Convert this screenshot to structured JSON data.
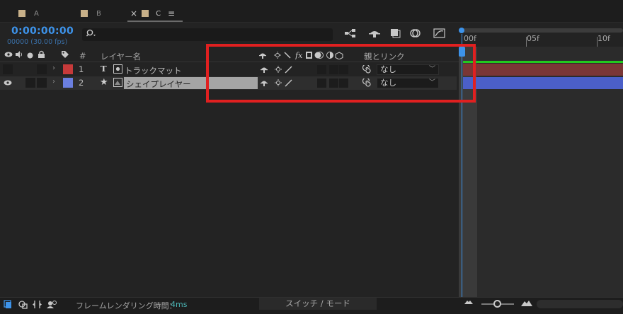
{
  "tabs": [
    {
      "label": "A",
      "active": false
    },
    {
      "label": "B",
      "active": false
    },
    {
      "label": "C",
      "active": true
    }
  ],
  "tab_close": "×",
  "tab_menu": "≡",
  "timecode": "0:00:00:00",
  "fps": "00000 (30.00 fps)",
  "ruler": {
    "ticks": [
      "00f",
      "05f",
      "10f"
    ]
  },
  "header": {
    "number": "#",
    "layer_name": "レイヤー名",
    "parent_link": "親とリンク"
  },
  "layers": [
    {
      "num": "1",
      "type_glyph": "T",
      "name": "トラックマット",
      "parent": "なし",
      "color": "#c63a3a",
      "visible": false
    },
    {
      "num": "2",
      "type_glyph": "★",
      "name": "シェイプレイヤー",
      "parent": "なし",
      "color": "#6b7fe0",
      "visible": true
    }
  ],
  "status": {
    "render_label": "フレームレンダリング時間：",
    "render_value": "4ms",
    "switch_mode": "スイッチ / モード"
  },
  "colors": {
    "accent": "#3d93ea",
    "highlight": "#e02020",
    "track_matte_bar": "#7a3636",
    "shape_bar": "#4b5fc8",
    "work_area": "#22c91e"
  }
}
